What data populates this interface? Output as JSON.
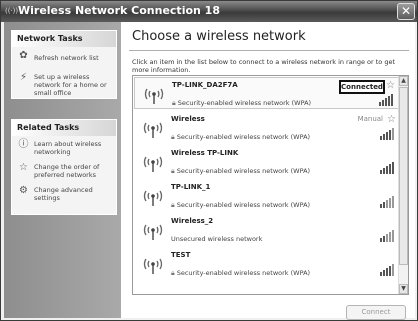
{
  "window": {
    "title": "Wireless Network Connection 18",
    "title_icon": "wireless-signal-icon",
    "close_label": "✕"
  },
  "sidebar": {
    "network_tasks": {
      "header": "Network Tasks",
      "items": [
        {
          "label": "Refresh network list",
          "icon": "refresh-icon"
        },
        {
          "label": "Set up a wireless network for a home or small office",
          "icon": "setup-wizard-icon"
        }
      ]
    },
    "related_tasks": {
      "header": "Related Tasks",
      "items": [
        {
          "label": "Learn about wireless networking",
          "icon": "info-icon"
        },
        {
          "label": "Change the order of preferred networks",
          "icon": "star-icon"
        },
        {
          "label": "Change advanced settings",
          "icon": "settings-icon"
        }
      ]
    }
  },
  "main": {
    "heading": "Choose a wireless network",
    "instructions": "Click an item in the list below to connect to a wireless network in range or to get more information.",
    "networks": [
      {
        "name": "TP-LINK_DA2F7A",
        "security": "Security-enabled wireless network (WPA)",
        "status": "Connected",
        "signal_bars": 5,
        "preferred": true
      },
      {
        "name": "Wireless",
        "security": "Security-enabled wireless network (WPA)",
        "status": "Manual",
        "signal_bars": 4,
        "preferred": true
      },
      {
        "name": "Wireless TP-LINK",
        "security": "Security-enabled wireless network (WPA)",
        "status": "",
        "signal_bars": 5,
        "preferred": false
      },
      {
        "name": "TP-LINK_1",
        "security": "Security-enabled wireless network (WPA)",
        "status": "",
        "signal_bars": 2,
        "preferred": false
      },
      {
        "name": "Wireless_2",
        "security": "Unsecured wireless network",
        "status": "",
        "signal_bars": 2,
        "preferred": false
      },
      {
        "name": "TEST",
        "security": "Security-enabled wireless network (WPA)",
        "status": "",
        "signal_bars": 4,
        "preferred": false
      }
    ],
    "connect_button": "Connect"
  },
  "colors": {
    "titlebar": "#4b4b4b",
    "sidebar_bg": "#a0a0a0",
    "connected_outline": "#111111"
  }
}
